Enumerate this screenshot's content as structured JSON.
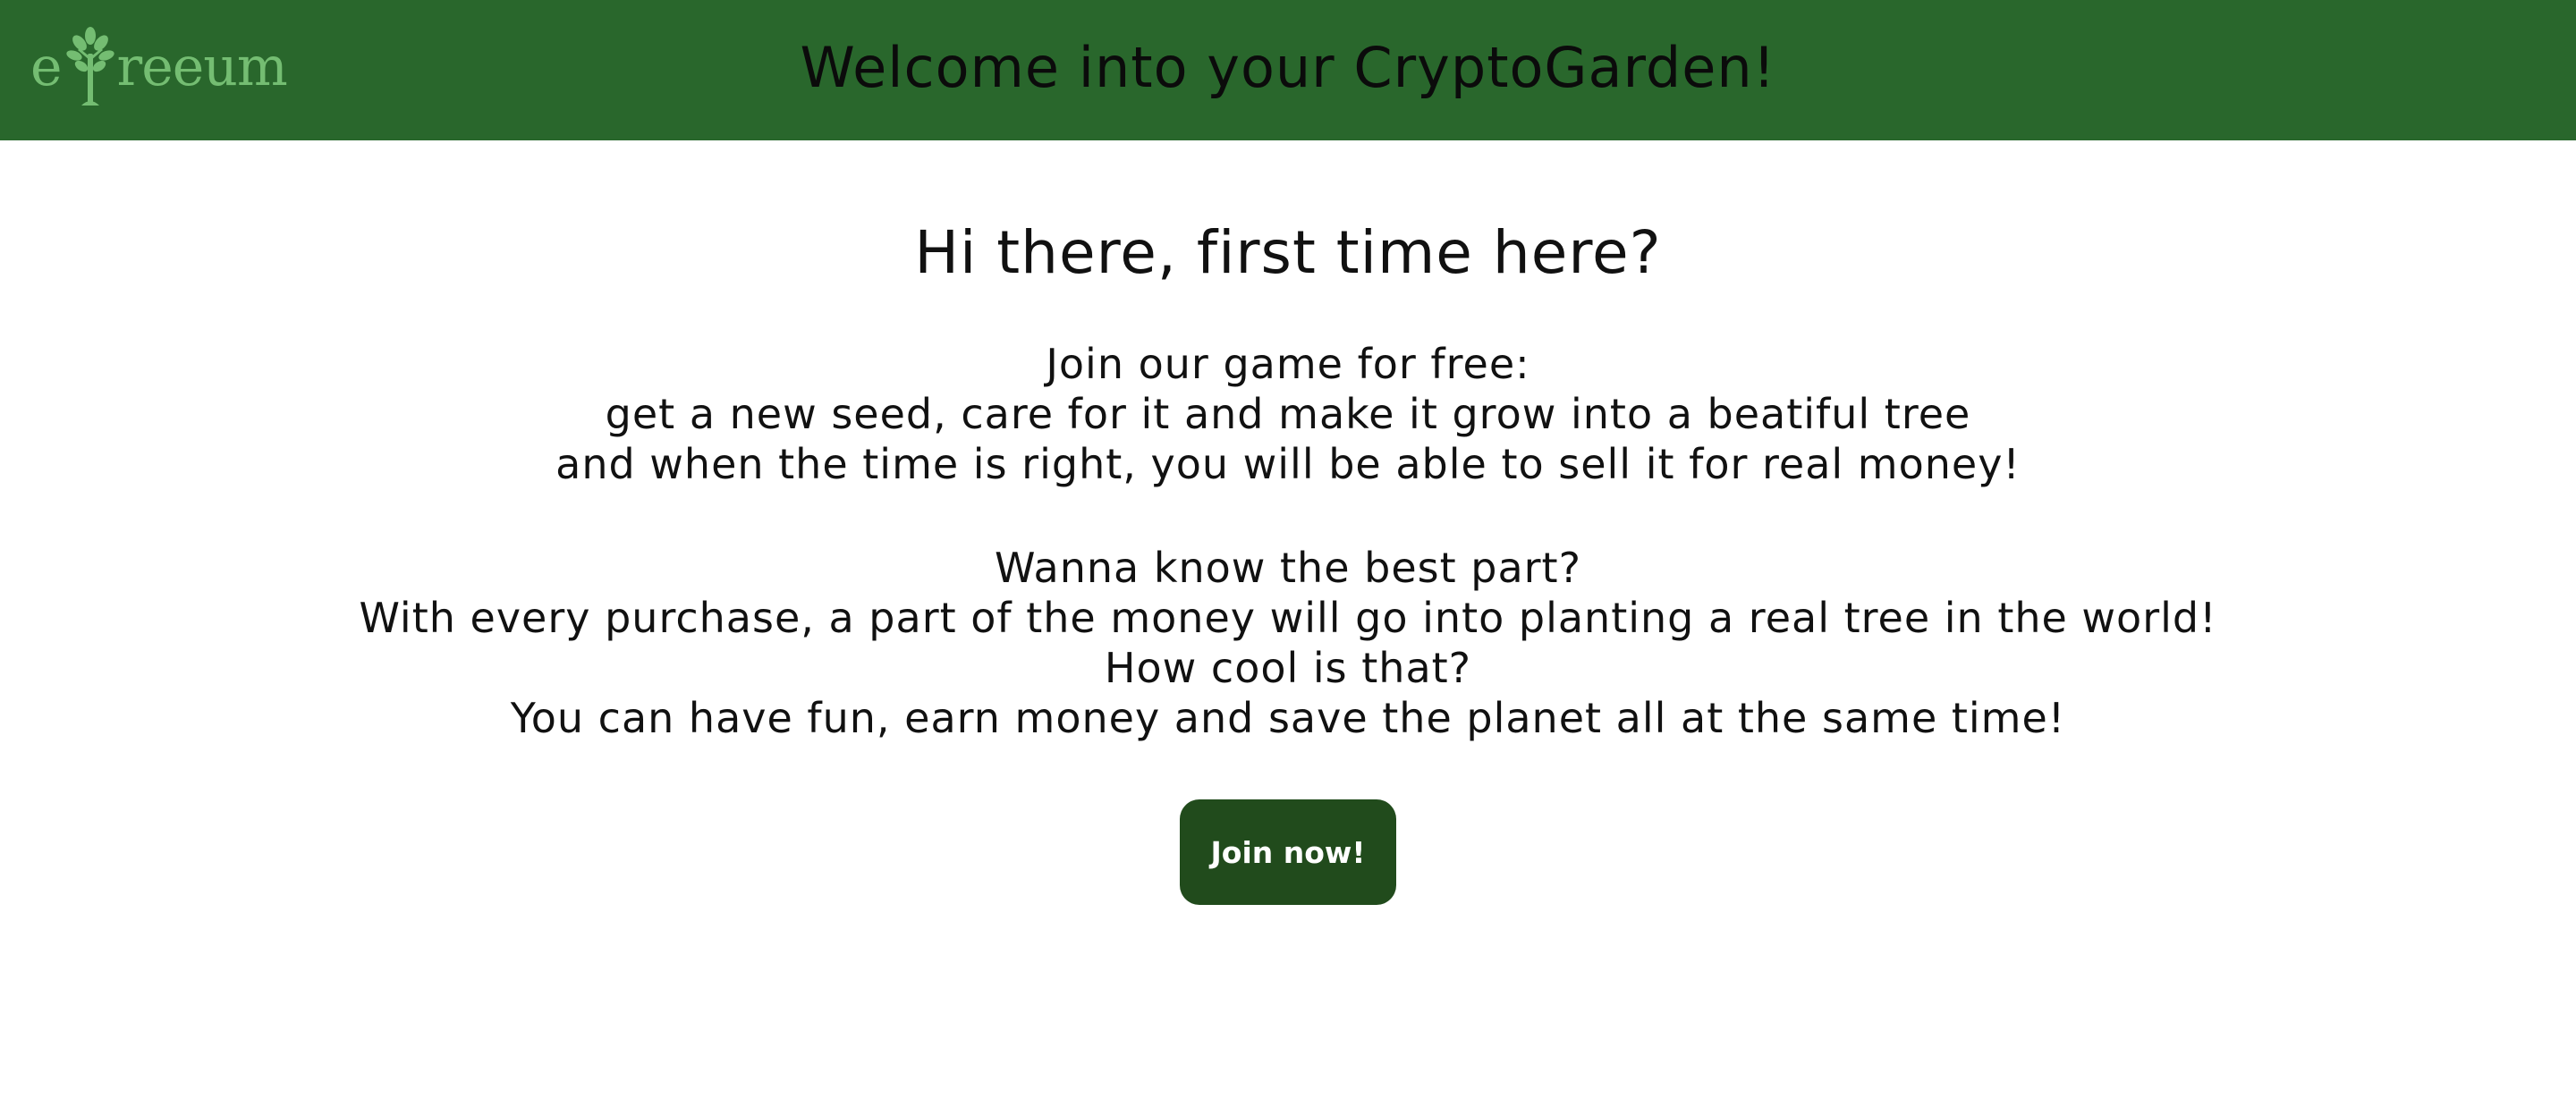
{
  "header": {
    "logo": {
      "prefix": "e",
      "suffix": "reeum",
      "icon": "tree-icon",
      "color": "#74bd72"
    },
    "title": "Welcome into your CryptoGarden!",
    "background": "#29672c"
  },
  "main": {
    "heading": "Hi there, first time here?",
    "intro_lines": [
      "Join our game for free:",
      "get a new seed, care for it and make it grow into a beatiful tree",
      "and when the time is right, you will be able to sell it for real money!"
    ],
    "pitch_lines": [
      "Wanna know the best part?",
      "With every purchase, a part of the money will go into planting a real tree in the world!",
      "How cool is that?",
      "You can have fun, earn money and save the planet all at the same time!"
    ],
    "join_button": {
      "label": "Join now!",
      "color": "#214b1c"
    }
  }
}
